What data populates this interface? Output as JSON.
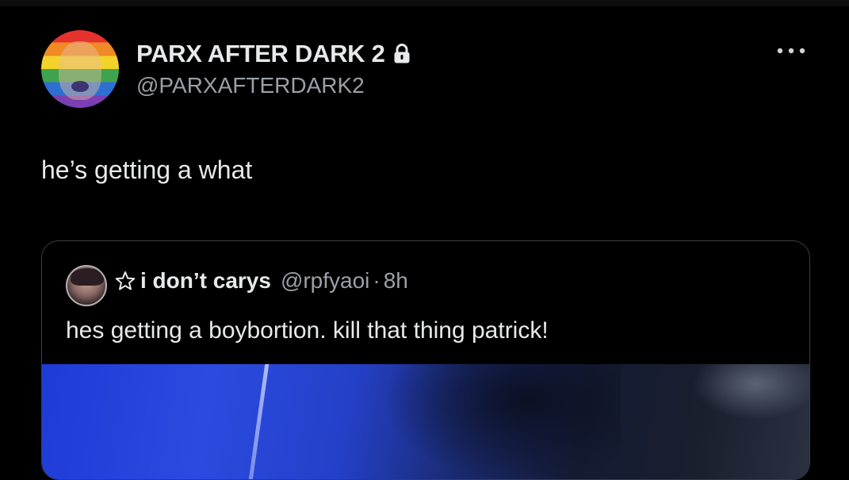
{
  "tweet": {
    "author": {
      "display_name": "PARX AFTER DARK 2",
      "handle": "@PARXAFTERDARK2",
      "protected_icon": "lock-icon",
      "avatar_style": "rainbow-pride-flag-overlay"
    },
    "more_icon": "more-horizontal-icon",
    "text": "he’s getting a what"
  },
  "quote": {
    "author": {
      "display_name": "i don’t carys",
      "handle": "@rpfyaoi",
      "name_prefix_icon": "star-outline-icon"
    },
    "separator": "·",
    "time": "8h",
    "text": "hes getting a boybortion. kill that thing patrick!",
    "media": {
      "dominant_colors": [
        "#1e3bd6",
        "#141b33",
        "#2a3140"
      ]
    }
  },
  "colors": {
    "background": "#000000",
    "primary_text": "#e7e9ea",
    "secondary_text": "#9aa0a6",
    "card_border": "#3a3f44"
  }
}
